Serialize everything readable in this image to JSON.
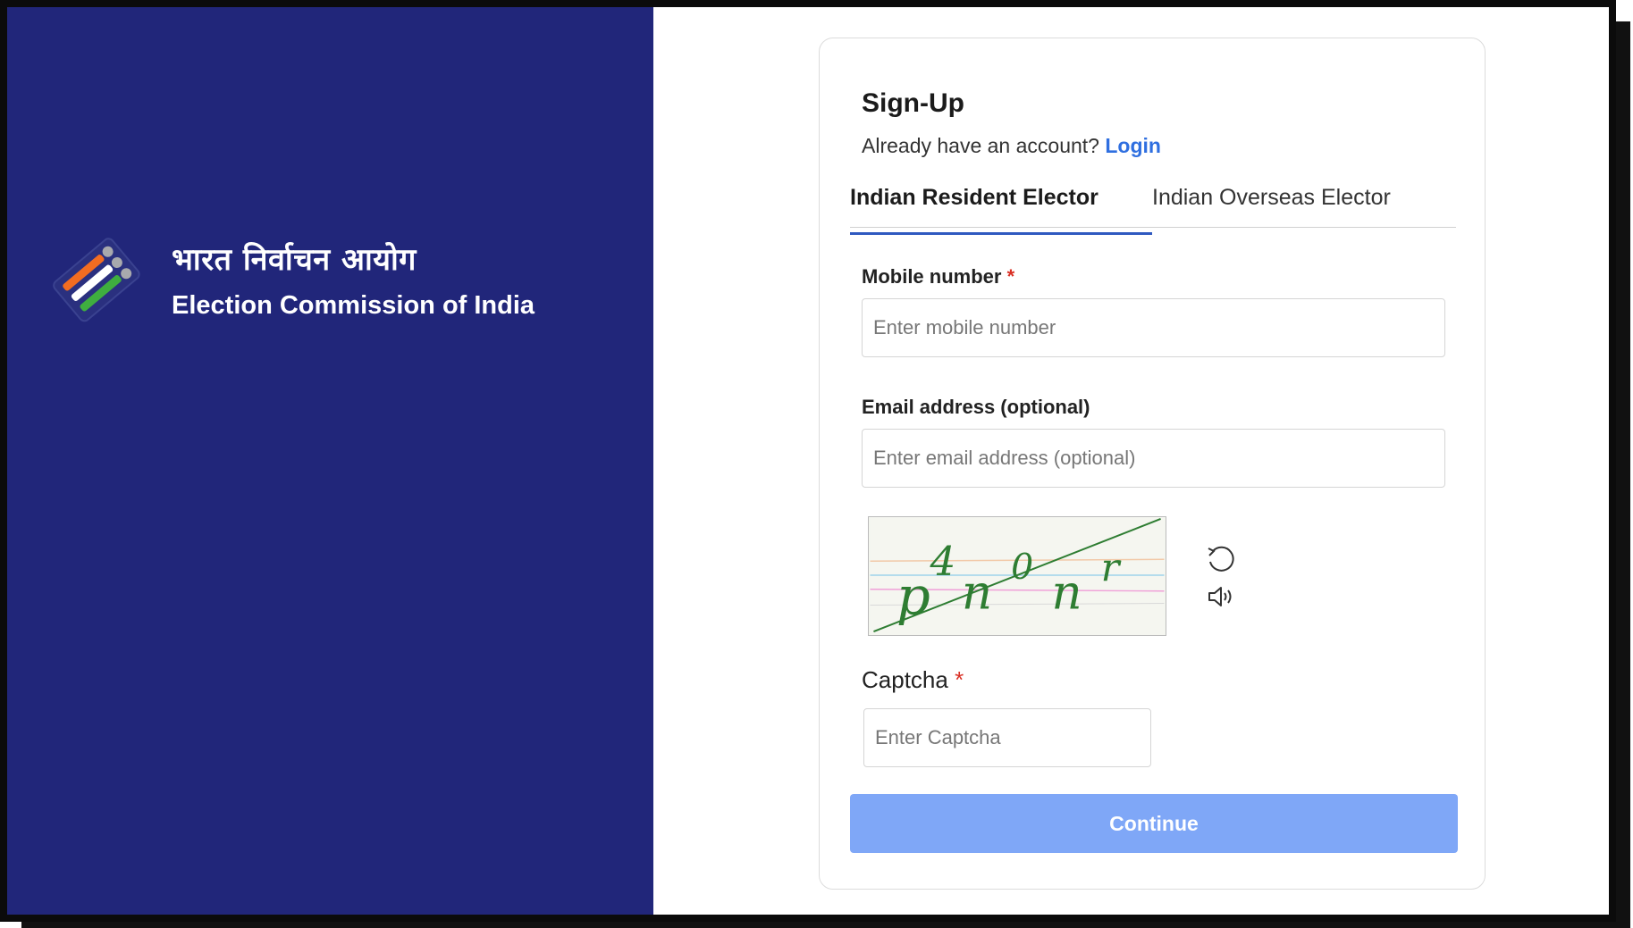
{
  "brand": {
    "hindi_name": "भारत निर्वाचन आयोग",
    "english_name": "Election Commission of India",
    "panel_color": "#21267a"
  },
  "form": {
    "title": "Sign-Up",
    "account_prompt": "Already have an account?",
    "login_link": "Login",
    "tabs": [
      {
        "label": "Indian Resident Elector",
        "active": true
      },
      {
        "label": "Indian Overseas Elector",
        "active": false
      }
    ],
    "mobile": {
      "label": "Mobile number",
      "required_mark": "*",
      "placeholder": "Enter mobile number",
      "value": ""
    },
    "email": {
      "label": "Email address (optional)",
      "placeholder": "Enter email address (optional)",
      "value": ""
    },
    "captcha": {
      "image_text": "p4n0nr",
      "refresh_icon": "refresh-icon",
      "audio_icon": "speaker-icon",
      "label": "Captcha",
      "required_mark": "*",
      "placeholder": "Enter Captcha",
      "value": ""
    },
    "continue_label": "Continue",
    "continue_color": "#7fa7f7",
    "link_color": "#2f6fe0"
  }
}
